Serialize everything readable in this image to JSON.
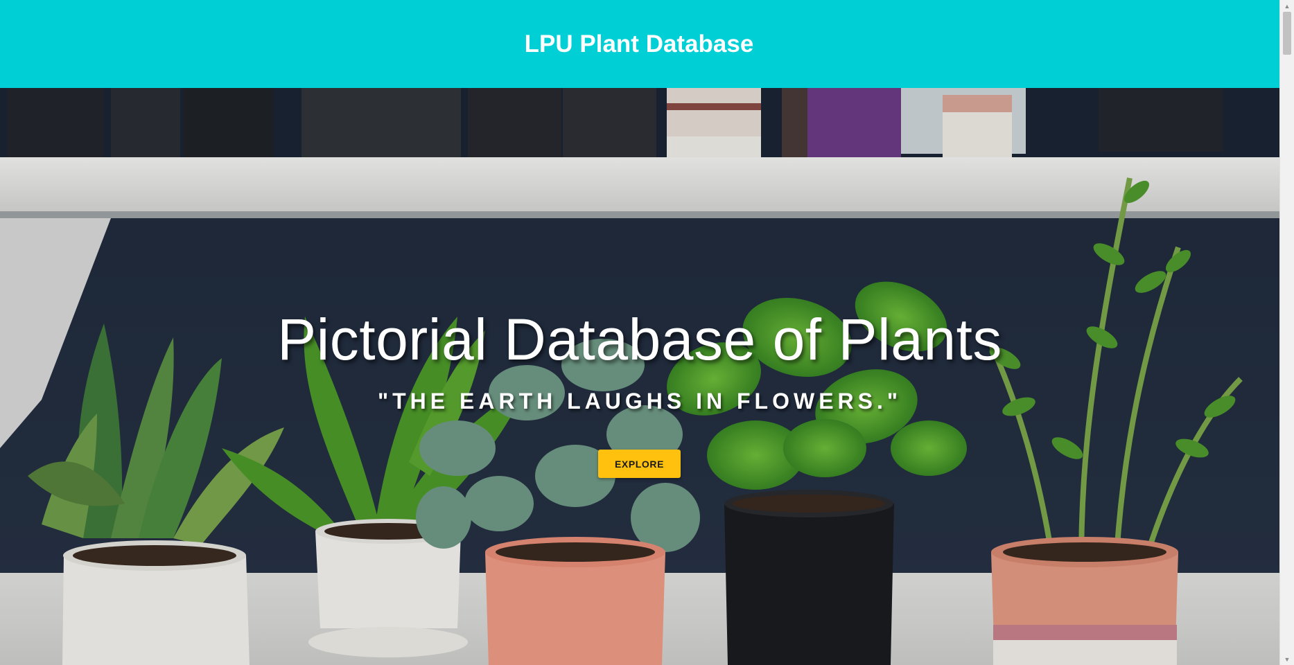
{
  "header": {
    "title": "LPU Plant Database"
  },
  "hero": {
    "title": "Pictorial Database of Plants",
    "quote": "\"THE EARTH LAUGHS IN FLOWERS.\"",
    "explore_label": "EXPLORE",
    "background_image": "potted-plants-on-shelf"
  },
  "colors": {
    "header_bg": "#00cfd6",
    "button_bg": "#ffc00e",
    "text": "#ffffff"
  },
  "scrollbar": {
    "up_icon": "chevron-up-icon",
    "down_icon": "chevron-down-icon"
  }
}
